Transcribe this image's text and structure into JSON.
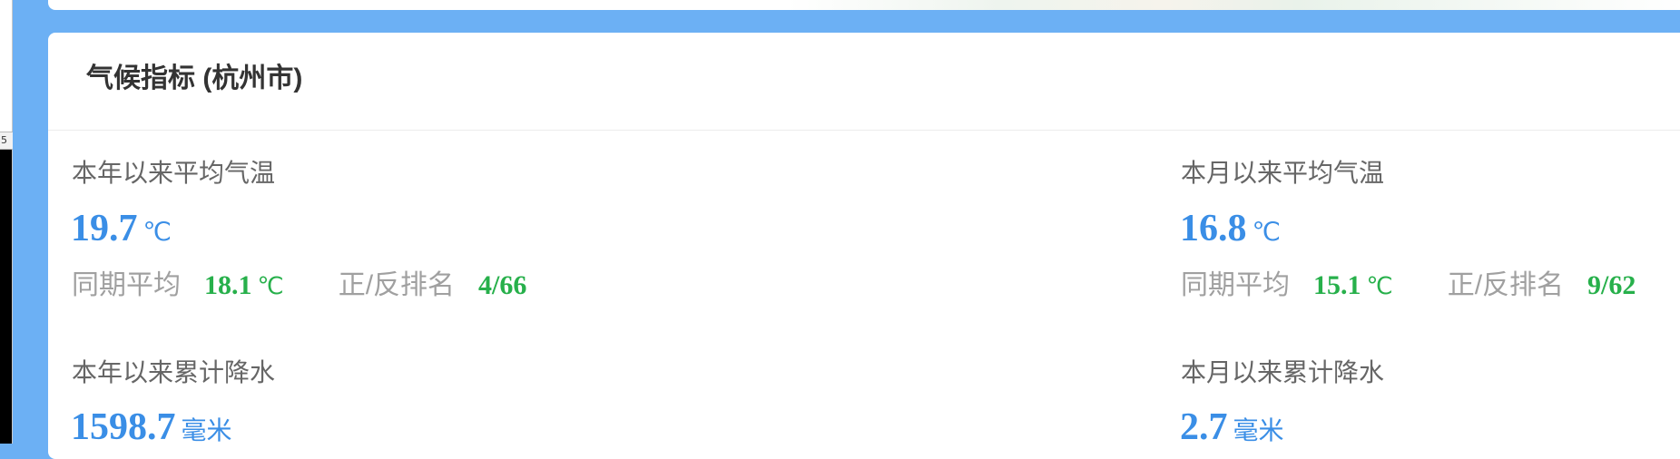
{
  "side": {
    "mark": "5"
  },
  "card": {
    "title": "气候指标 (杭州市)",
    "metrics": [
      {
        "label": "本年以来平均气温",
        "value": "19.7",
        "unit": "℃",
        "same_period_label": "同期平均",
        "same_period_value": "18.1",
        "same_period_unit": "℃",
        "rank_label": "正/反排名",
        "rank_value": "4/66"
      },
      {
        "label": "本月以来平均气温",
        "value": "16.8",
        "unit": "℃",
        "same_period_label": "同期平均",
        "same_period_value": "15.1",
        "same_period_unit": "℃",
        "rank_label": "正/反排名",
        "rank_value": "9/62"
      },
      {
        "label": "本年以来累计降水",
        "value": "1598.7",
        "unit": "毫米"
      },
      {
        "label": "本月以来累计降水",
        "value": "2.7",
        "unit": "毫米"
      }
    ]
  },
  "colors": {
    "background": "#6cb0f4",
    "value_blue": "#3a8ee6",
    "value_green": "#27b04b",
    "label_gray": "#666666",
    "sub_label_gray": "#a0a0a0"
  }
}
